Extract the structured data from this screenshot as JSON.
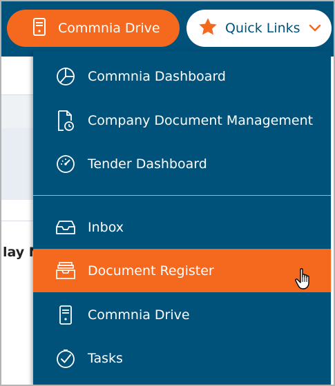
{
  "header": {
    "drive_button": {
      "label": "Commnia Drive",
      "icon": "server-icon"
    },
    "quick_links": {
      "label": "Quick Links",
      "icon": "star-icon",
      "chevron": "chevron-down-icon"
    }
  },
  "background": {
    "heading_fragment": "lay N"
  },
  "menu": {
    "items": [
      {
        "label": "Commnia Dashboard",
        "icon": "pie-chart-icon"
      },
      {
        "label": "Company Document Management",
        "icon": "document-clock-icon"
      },
      {
        "label": "Tender Dashboard",
        "icon": "gauge-icon"
      },
      {
        "label": "Inbox",
        "icon": "inbox-tray-icon"
      },
      {
        "label": "Document Register",
        "icon": "archive-tray-icon",
        "active": true
      },
      {
        "label": "Commnia Drive",
        "icon": "server-icon"
      },
      {
        "label": "Tasks",
        "icon": "check-circle-icon"
      }
    ]
  },
  "colors": {
    "primary": "#00527a",
    "accent": "#f5691f",
    "white": "#ffffff"
  }
}
